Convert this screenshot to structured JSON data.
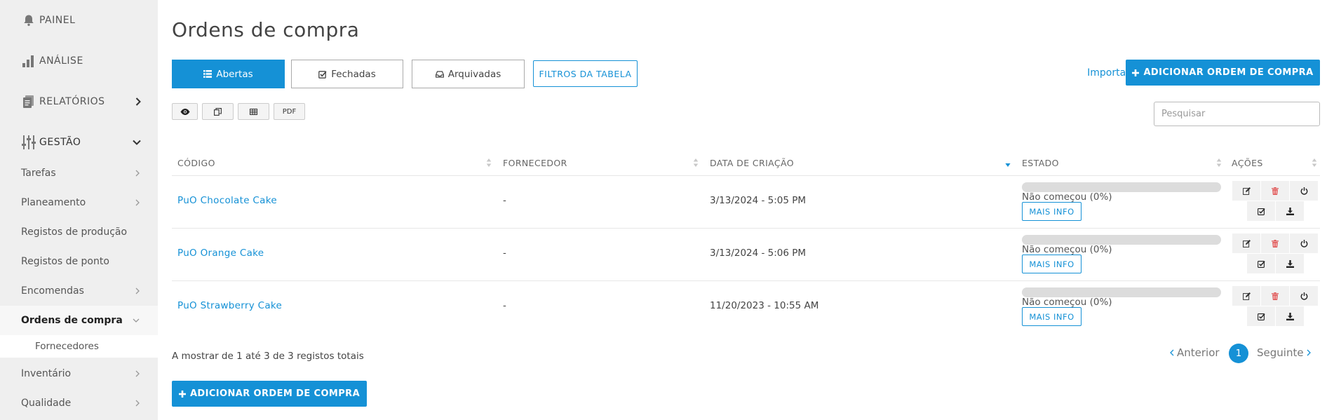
{
  "sidebar": {
    "top_items": [
      {
        "label": "PAINEL",
        "icon": "bell-icon"
      },
      {
        "label": "ANÁLISE",
        "icon": "bar-chart-icon"
      },
      {
        "label": "RELATÓRIOS",
        "icon": "report-icon"
      },
      {
        "label": "GESTÃO",
        "icon": "sliders-icon"
      }
    ],
    "sub_items": [
      {
        "label": "Tarefas"
      },
      {
        "label": "Planeamento"
      },
      {
        "label": "Registos de produção"
      },
      {
        "label": "Registos de ponto"
      },
      {
        "label": "Encomendas"
      },
      {
        "label": "Ordens de compra"
      },
      {
        "label": "Fornecedores"
      },
      {
        "label": "Inventário"
      },
      {
        "label": "Qualidade"
      }
    ]
  },
  "page": {
    "title": "Ordens de compra"
  },
  "tabs": [
    {
      "label": "Abertas",
      "icon": "list-icon",
      "active": true
    },
    {
      "label": "Fechadas",
      "icon": "check-square-icon",
      "active": false
    },
    {
      "label": "Arquivadas",
      "icon": "inbox-icon",
      "active": false
    }
  ],
  "toolbar": {
    "filters_label": "FILTROS DA TABELA",
    "import_label": "Importação",
    "add_label": "ADICIONAR ORDEM DE COMPRA",
    "export_buttons": [
      {
        "icon": "eye-icon"
      },
      {
        "icon": "copy-icon"
      },
      {
        "icon": "table-icon"
      },
      {
        "label": "PDF"
      }
    ],
    "search_placeholder": "Pesquisar"
  },
  "table": {
    "columns": [
      "CÓDIGO",
      "FORNECEDOR",
      "DATA DE CRIAÇÃO",
      "ESTADO",
      "AÇÕES"
    ],
    "rows": [
      {
        "code": "PuO Chocolate Cake",
        "supplier": "-",
        "created": "3/13/2024 - 5:05 PM",
        "status": "Não começou (0%)",
        "progress": 0,
        "more": "MAIS INFO"
      },
      {
        "code": "PuO Orange Cake",
        "supplier": "-",
        "created": "3/13/2024 - 5:06 PM",
        "status": "Não começou (0%)",
        "progress": 0,
        "more": "MAIS INFO"
      },
      {
        "code": "PuO Strawberry Cake",
        "supplier": "-",
        "created": "11/20/2023 - 10:55 AM",
        "status": "Não começou (0%)",
        "progress": 0,
        "more": "MAIS INFO"
      }
    ],
    "info": "A mostrar de 1 até 3 de 3 registos totais"
  },
  "pagination": {
    "prev": "Anterior",
    "current": "1",
    "next": "Seguinte"
  },
  "colors": {
    "accent": "#1591d6",
    "delete": "#e05a5a",
    "sidebar_bg": "#efefef"
  }
}
